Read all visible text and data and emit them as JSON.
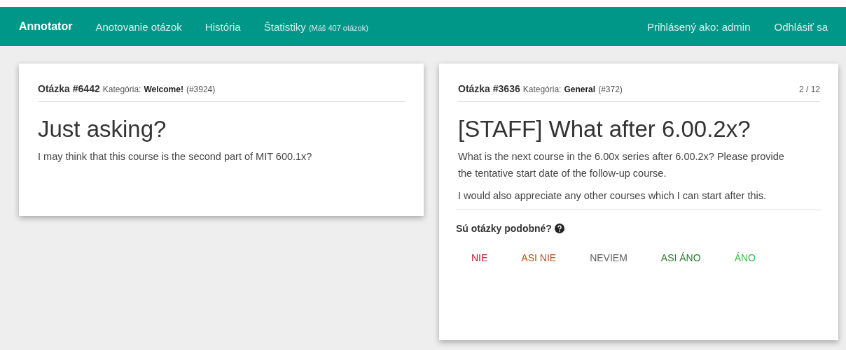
{
  "navbar": {
    "brand": "Annotator",
    "links": [
      {
        "label": "Anotovanie otázok"
      },
      {
        "label": "História"
      },
      {
        "label": "Štatistiky",
        "note": "(Máš 407 otázok)"
      }
    ],
    "user": "Prihlásený ako: admin",
    "logout": "Odhlásiť sa"
  },
  "questions": [
    {
      "number": "Otázka #6442",
      "category_label": "Kategória:",
      "category": "Welcome!",
      "category_id": "(#3924)",
      "title": "Just asking?",
      "paragraphs": [
        "I may think that this course is the second part of MIT 600.1x?"
      ]
    },
    {
      "number": "Otázka #3636",
      "category_label": "Kategória:",
      "category": "General",
      "category_id": "(#372)",
      "counter": "2 / 12",
      "title": "[STAFF] What after 6.00.2x?",
      "paragraphs": [
        "What is the next course in the 6.00x series after 6.00.2x? Please provide the tentative start date of the follow-up course.",
        "I would also appreciate any other courses which I can start after this."
      ]
    }
  ],
  "similarity": {
    "prompt": "Sú otázky podobné?",
    "answers": [
      {
        "label": "NIE",
        "color": "#c62039"
      },
      {
        "label": "ASI NIE",
        "color": "#b5521e"
      },
      {
        "label": "NEVIEM",
        "color": "#616161"
      },
      {
        "label": "ASI ÁNO",
        "color": "#2e7d32"
      },
      {
        "label": "ÁNO",
        "color": "#3dbb4f"
      }
    ]
  }
}
